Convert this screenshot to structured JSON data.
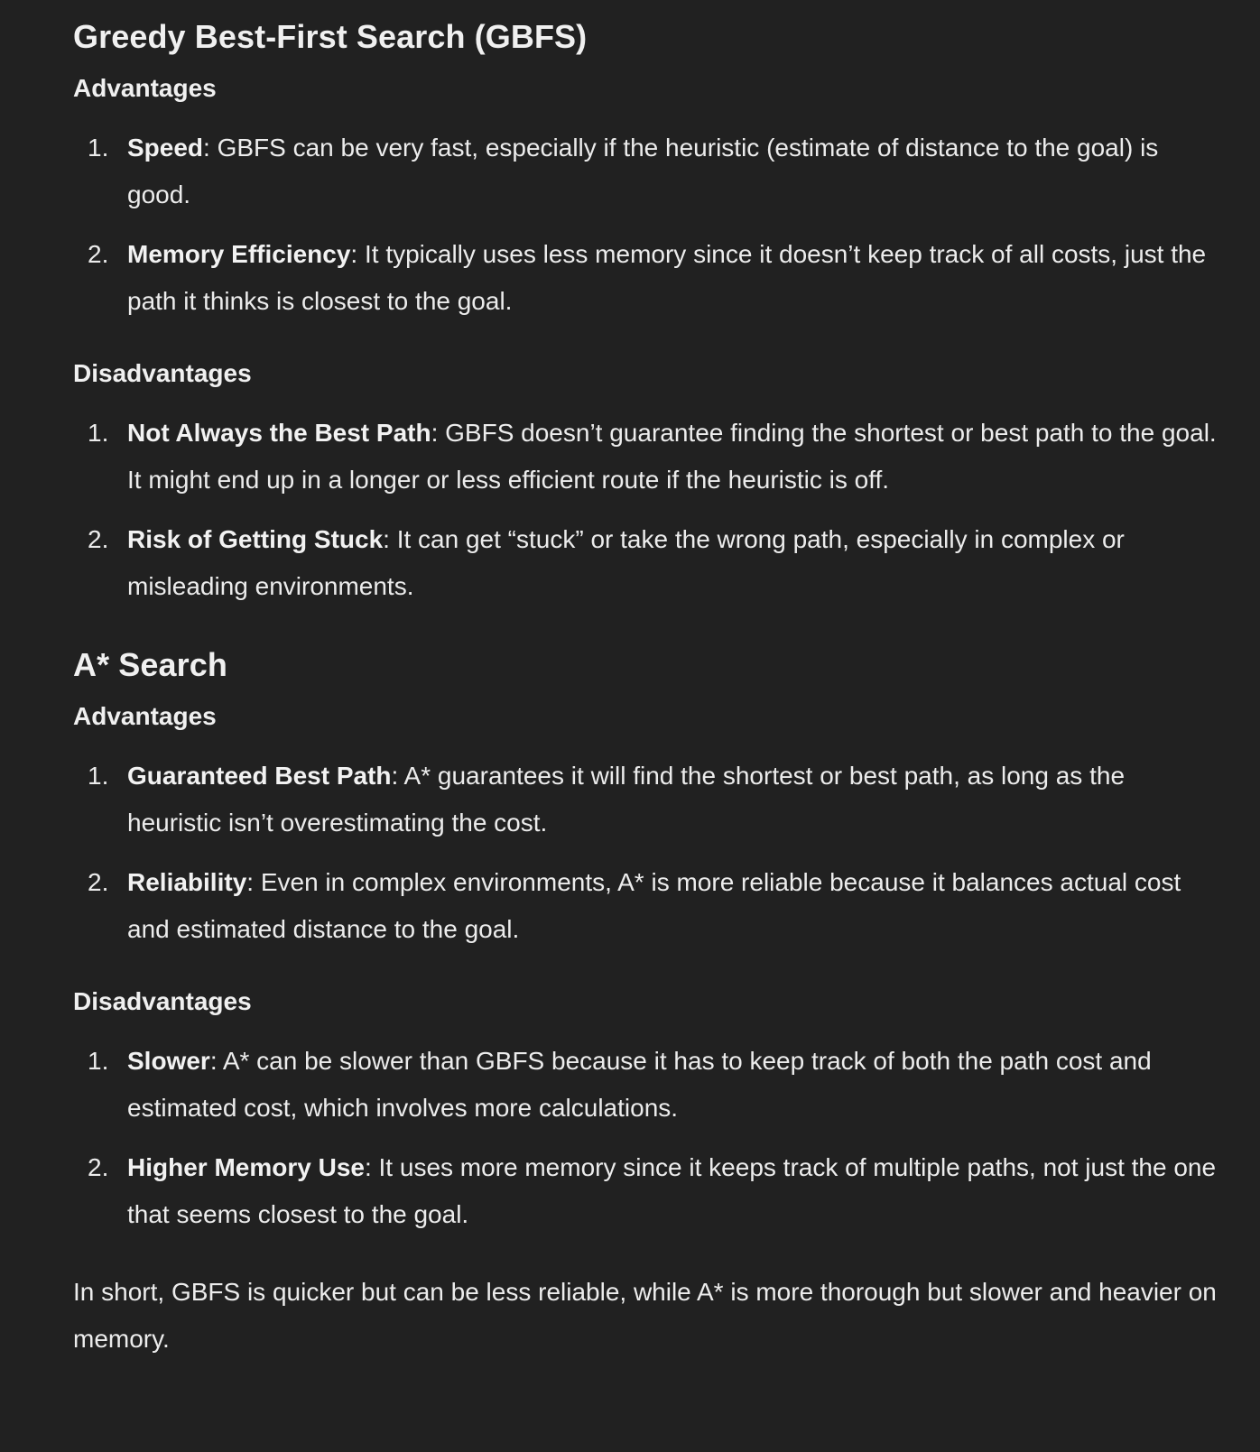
{
  "sections": [
    {
      "title": "Greedy Best-First Search (GBFS)",
      "groups": [
        {
          "heading": "Advantages",
          "items": [
            {
              "num": "1.",
              "term": "Speed",
              "text": ": GBFS can be very fast, especially if the heuristic (estimate of distance to the goal) is good."
            },
            {
              "num": "2.",
              "term": "Memory Efficiency",
              "text": ": It typically uses less memory since it doesn’t keep track of all costs, just the path it thinks is closest to the goal."
            }
          ]
        },
        {
          "heading": "Disadvantages",
          "items": [
            {
              "num": "1.",
              "term": "Not Always the Best Path",
              "text": ": GBFS doesn’t guarantee finding the shortest or best path to the goal. It might end up in a longer or less efficient route if the heuristic is off."
            },
            {
              "num": "2.",
              "term": "Risk of Getting Stuck",
              "text": ": It can get “stuck” or take the wrong path, especially in complex or misleading environments."
            }
          ]
        }
      ]
    },
    {
      "title": "A* Search",
      "groups": [
        {
          "heading": "Advantages",
          "items": [
            {
              "num": "1.",
              "term": "Guaranteed Best Path",
              "text": ": A* guarantees it will find the shortest or best path, as long as the heuristic isn’t overestimating the cost."
            },
            {
              "num": "2.",
              "term": "Reliability",
              "text": ": Even in complex environments, A* is more reliable because it balances actual cost and estimated distance to the goal."
            }
          ]
        },
        {
          "heading": "Disadvantages",
          "items": [
            {
              "num": "1.",
              "term": "Slower",
              "text": ": A* can be slower than GBFS because it has to keep track of both the path cost and estimated cost, which involves more calculations."
            },
            {
              "num": "2.",
              "term": "Higher Memory Use",
              "text": ": It uses more memory since it keeps track of multiple paths, not just the one that seems closest to the goal."
            }
          ]
        }
      ]
    }
  ],
  "summary": "In short, GBFS is quicker but can be less reliable, while A* is more thorough but slower and heavier on memory."
}
